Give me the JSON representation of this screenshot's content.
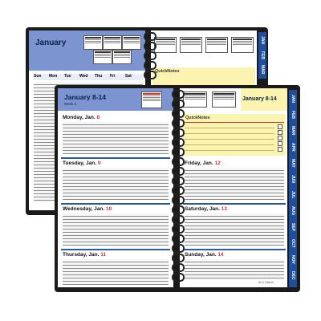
{
  "back_planner": {
    "header_title": "January",
    "weekday_labels": [
      "Sun",
      "Mon",
      "Tue",
      "Wed",
      "Thu",
      "Fri",
      "Sat"
    ],
    "quicknotes_label": "QuickNotes",
    "month_tabs": [
      "JAN",
      "FEB",
      "MAR"
    ]
  },
  "front_planner": {
    "header_title": "January 8-14",
    "week_label": "Week 2",
    "right_header_title": "January 8-14",
    "quicknotes_label": "QuickNotes",
    "days": [
      {
        "prefix": "Monday, Jan. ",
        "num": "8"
      },
      {
        "prefix": "Tuesday, Jan. ",
        "num": "9"
      },
      {
        "prefix": "Wednesday, Jan. ",
        "num": "10"
      },
      {
        "prefix": "Thursday, Jan. ",
        "num": "11"
      },
      {
        "prefix": "Friday, Jan. ",
        "num": "12"
      },
      {
        "prefix": "Saturday, Jan. ",
        "num": "13"
      },
      {
        "prefix": "Sunday, Jan. ",
        "num": "14"
      }
    ],
    "month_tabs": [
      "JAN",
      "FEB",
      "MAR",
      "APR",
      "MAY",
      "JUN",
      "JUL",
      "AUG",
      "SEP",
      "OCT",
      "NOV",
      "DEC"
    ],
    "brand_mark": "At-A-Glance"
  },
  "colors": {
    "header_blue": "#7c95d0",
    "tab_blue": "#1f4f9c",
    "quicknotes_yellow": "#fbf3b0",
    "date_red": "#d2322d",
    "cover_black": "#1a1a1a"
  }
}
